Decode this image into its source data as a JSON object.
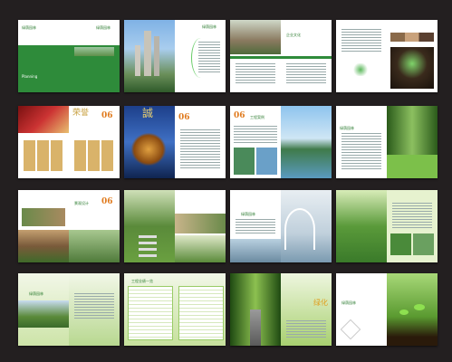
{
  "brand": {
    "logo_text": "绿荫园林",
    "primary_green": "#2e8b3a",
    "accent_orange": "#e07b1f"
  },
  "labels": {
    "cover_sub": "Planning",
    "sec_06_num": "06",
    "sec_06b_num": "06",
    "sec_06_title": "企业文化",
    "sec_06b_title": "工程案例",
    "honor_char": "荣誉",
    "integrity_char": "誠",
    "row3_num": "06",
    "row3_title": "景观设计",
    "table_title": "工程业绩一览",
    "road_char": "绿化"
  },
  "thumbnails_count": 16
}
